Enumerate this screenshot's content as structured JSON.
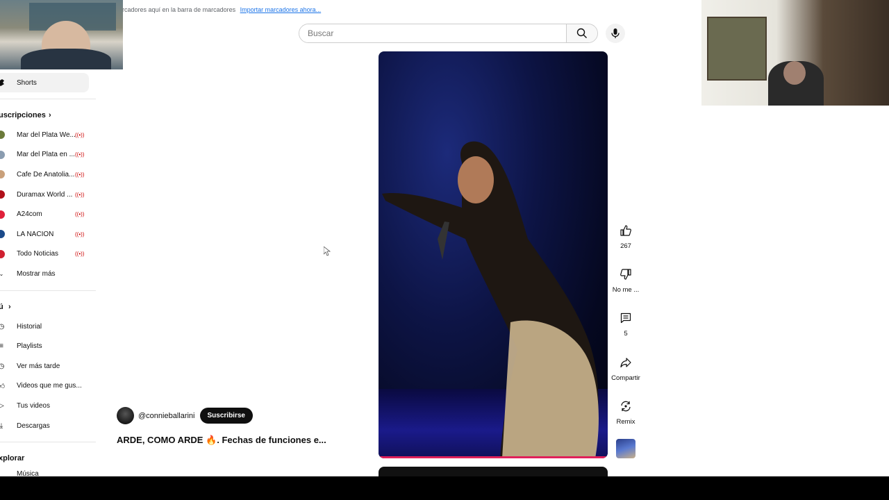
{
  "browser": {
    "bookmarks_text": "rcadores aquí en la barra de marcadores",
    "bookmarks_link": "Importar marcadores ahora..."
  },
  "search": {
    "placeholder": "Buscar"
  },
  "sidebar": {
    "shorts_label": "Shorts",
    "subscriptions_title": "uscripciones",
    "subscriptions": [
      {
        "label": "Mar del Plata We...",
        "avatar_color": "#6b7a3a"
      },
      {
        "label": "Mar del Plata en ...",
        "avatar_color": "#8a9cb0"
      },
      {
        "label": "Cafe De Anatolia...",
        "avatar_color": "#c9a07a"
      },
      {
        "label": "Duramax World ...",
        "avatar_color": "#b0101a"
      },
      {
        "label": "A24com",
        "avatar_color": "#e0203a"
      },
      {
        "label": "LA NACION",
        "avatar_color": "#1a4a8a"
      },
      {
        "label": "Todo Noticias",
        "avatar_color": "#d02030"
      }
    ],
    "show_more": "Mostrar más",
    "you_title": "ú",
    "you_items": [
      {
        "label": "Historial",
        "icon": "history-icon"
      },
      {
        "label": "Playlists",
        "icon": "playlist-icon"
      },
      {
        "label": "Ver más tarde",
        "icon": "watch-later-icon"
      },
      {
        "label": "Videos que me gus...",
        "icon": "like-icon"
      },
      {
        "label": "Tus videos",
        "icon": "video-icon"
      },
      {
        "label": "Descargas",
        "icon": "download-icon"
      }
    ],
    "explore_title": "xplorar",
    "explore_first": "Música"
  },
  "short": {
    "channel": "@connieballarini",
    "subscribe_label": "Suscribirse",
    "title": "ARDE, COMO ARDE 🔥.   Fechas de funciones e...",
    "likes": "267",
    "dislike_label": "No me ...",
    "comments": "5",
    "share_label": "Compartir",
    "remix_label": "Remix"
  },
  "colors": {
    "accent": "#e0205a",
    "live": "#cc0000"
  }
}
